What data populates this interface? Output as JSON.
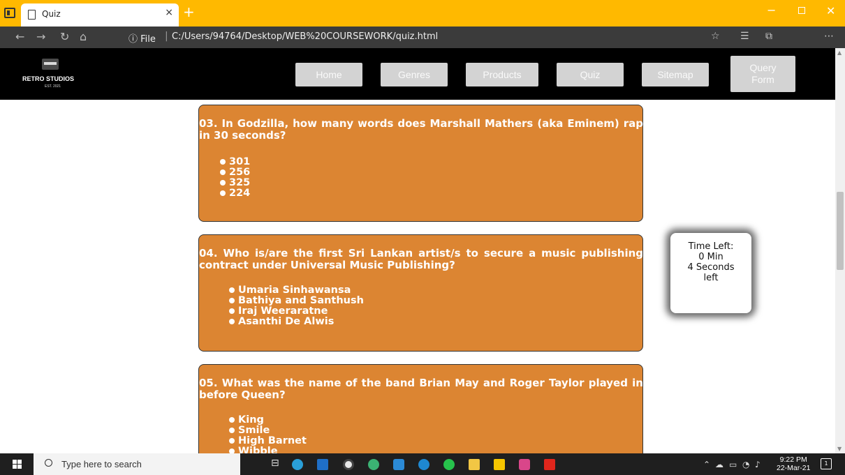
{
  "browser": {
    "tab_title": "Quiz",
    "tab_close": "×",
    "new_tab": "+",
    "address_prefix": "ⓘ File",
    "address_url": "C:/Users/94764/Desktop/WEB%20COURSEWORK/quiz.html",
    "minimize": "−",
    "close": "✕"
  },
  "site": {
    "logo_text": "RETRO STUDIOS",
    "logo_sub": "EST. 2021",
    "nav": [
      {
        "label": "Home"
      },
      {
        "label": "Genres"
      },
      {
        "label": "Products"
      },
      {
        "label": "Quiz"
      },
      {
        "label": "Sitemap"
      },
      {
        "label": "Query Form"
      }
    ]
  },
  "quiz": {
    "questions": [
      {
        "text": "03. In Godzilla, how many words does Marshall Mathers (aka Eminem) rap in 30 seconds?",
        "options": [
          "301",
          "256",
          "325",
          "224"
        ]
      },
      {
        "text": "04. Who is/are the first Sri Lankan artist/s to secure a music publishing contract under Universal Music Publishing?",
        "options": [
          "Umaria Sinhawansa",
          "Bathiya and Santhush",
          "Iraj Weeraratne",
          "Asanthi De Alwis"
        ]
      },
      {
        "text": "05. What was the name of the band Brian May and Roger Taylor played in before Queen?",
        "options": [
          "King",
          "Smile",
          "High Barnet",
          "Wibble"
        ]
      }
    ]
  },
  "timer": {
    "line1": "Time Left:",
    "line2": "0 Min",
    "line3": "4 Seconds",
    "line4": "left"
  },
  "taskbar": {
    "search_placeholder": "Type here to search",
    "time": "9:22 PM",
    "date": "22-Mar-21",
    "notifications": "1"
  },
  "colors": {
    "titlebar": "#ffb900",
    "question_box": "#dc8532",
    "nav_button": "#d3d3d3"
  }
}
